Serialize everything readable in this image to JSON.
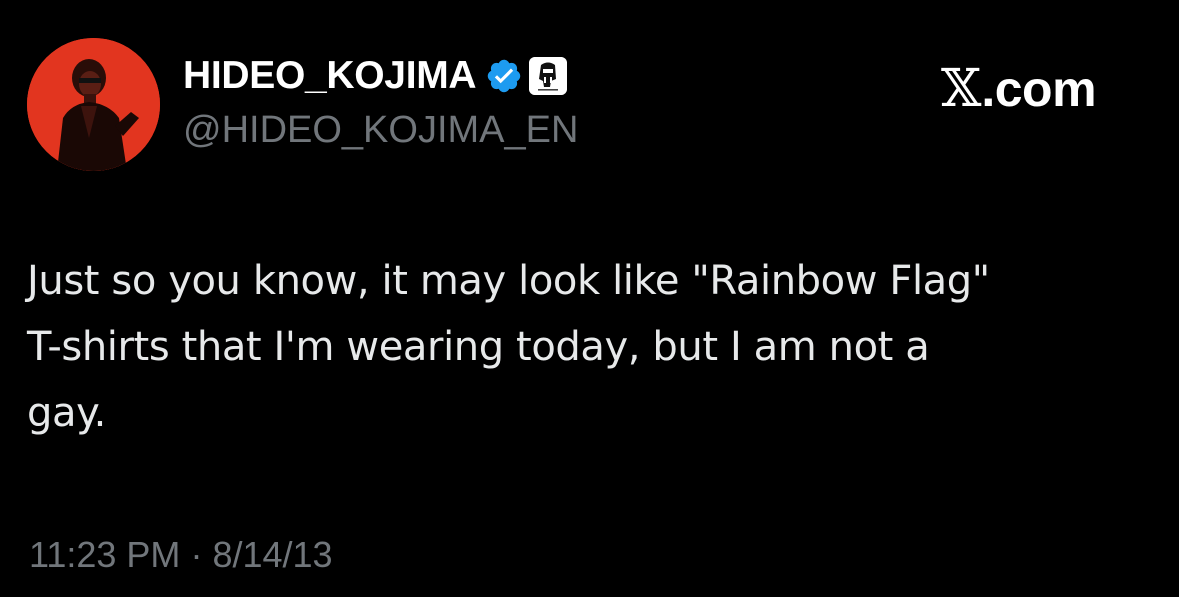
{
  "author": {
    "display_name": "HIDEO_KOJIMA",
    "handle": "@HIDEO_KOJIMA_EN",
    "avatar_icon": "profile-photo",
    "verified_badge_icon": "verified-check-icon",
    "affiliate_badge_icon": "kojima-productions-logo-icon"
  },
  "brand": {
    "x_glyph": "𝕏",
    "domain_suffix": ".com"
  },
  "tweet": {
    "lines": [
      "Just so you know, it may look like \"Rainbow Flag\"",
      "T-shirts that I'm wearing today, but I am not a",
      "gay."
    ],
    "time": "11:23 PM",
    "separator": "·",
    "date": "8/14/13"
  },
  "colors": {
    "background": "#000000",
    "text_primary": "#e7e9ea",
    "text_secondary": "#71767b",
    "verified_blue": "#1d9bf0",
    "avatar_red": "#e2351f"
  }
}
